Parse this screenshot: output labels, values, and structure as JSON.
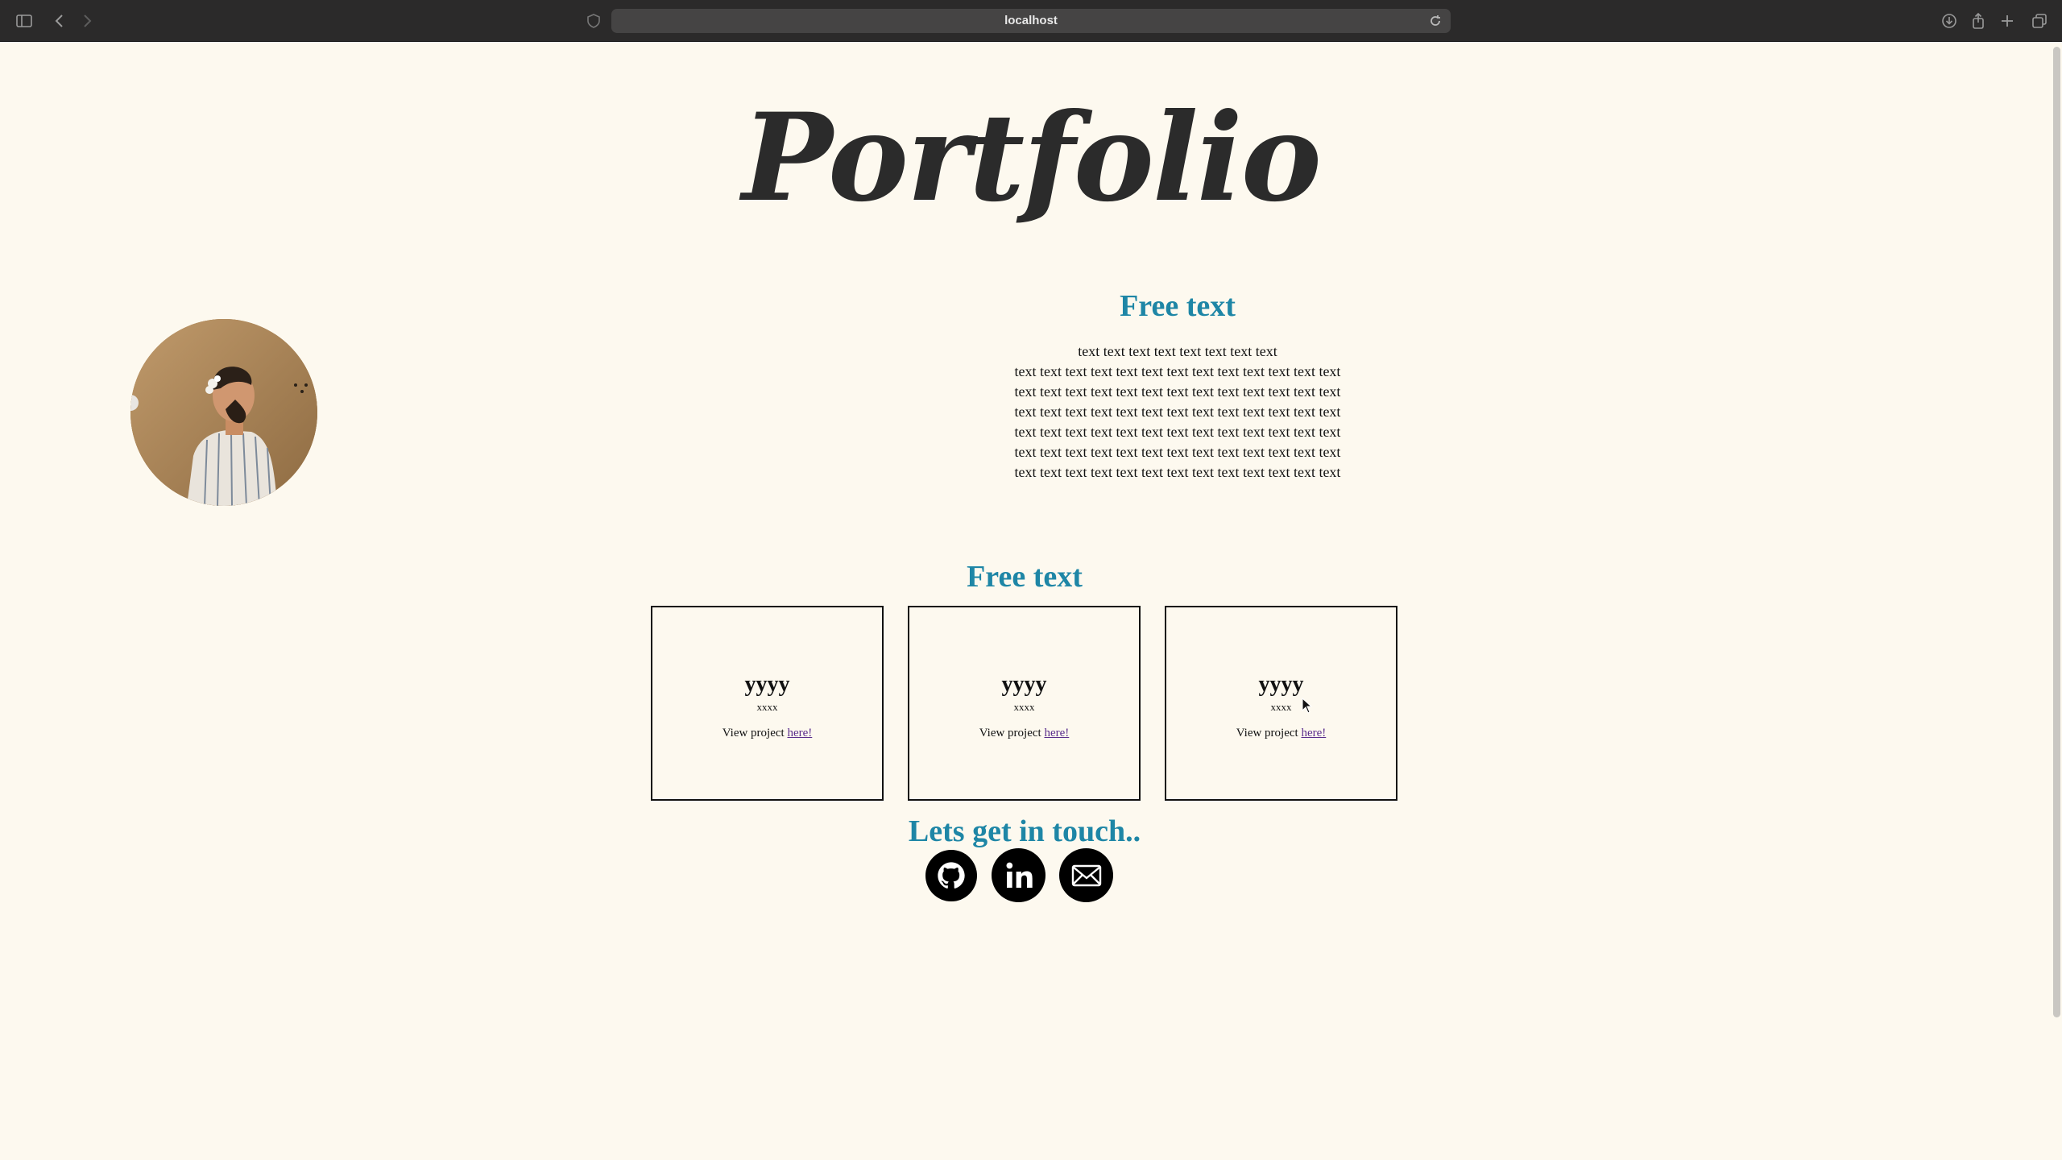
{
  "browser": {
    "url": "localhost"
  },
  "page": {
    "title": "Portfolio",
    "about": {
      "heading": "Free text",
      "lines": [
        "text text text text text text text text",
        "text text text text text text text text text text text text text",
        "text text text text text text text text text text text text text",
        "text text text text text text text text text text text text text",
        "text text text text text text text text text text text text text",
        "text text text text text text text text text text text text text",
        "text text text text text text text text text text text text text"
      ]
    },
    "projects": {
      "heading": "Free text",
      "cards": [
        {
          "title": "yyyy",
          "subtitle": "xxxx",
          "link_prefix": "View project",
          "link_text": "here!"
        },
        {
          "title": "yyyy",
          "subtitle": "xxxx",
          "link_prefix": "View project",
          "link_text": "here!"
        },
        {
          "title": "yyyy",
          "subtitle": "xxxx",
          "link_prefix": "View project",
          "link_text": "here!"
        }
      ]
    },
    "contact": {
      "heading": "Lets get in touch..",
      "icons": [
        "github-icon",
        "linkedin-icon",
        "email-icon"
      ]
    }
  },
  "colors": {
    "background": "#fdf9ef",
    "heading_accent": "#1e86a6",
    "link_visited": "#5a2d8c"
  }
}
